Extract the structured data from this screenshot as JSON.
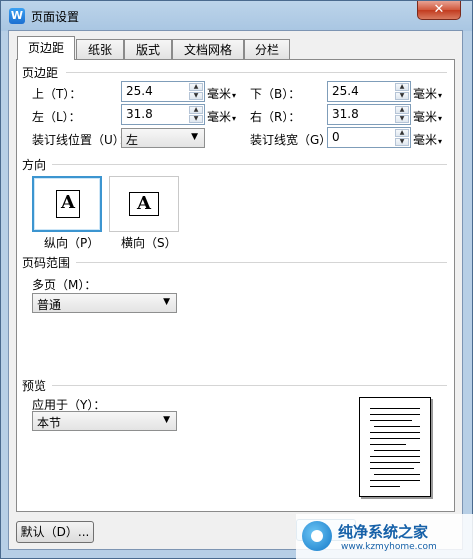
{
  "window": {
    "title": "页面设置",
    "app_icon_letter": "W",
    "close_label": "✕"
  },
  "tabs": [
    {
      "label": "页边距",
      "active": true
    },
    {
      "label": "纸张",
      "active": false
    },
    {
      "label": "版式",
      "active": false
    },
    {
      "label": "文档网格",
      "active": false
    },
    {
      "label": "分栏",
      "active": false
    }
  ],
  "margins": {
    "section_title": "页边距",
    "top": {
      "label": "上（T）：",
      "value": "25.4",
      "unit": "毫米"
    },
    "bottom": {
      "label": "下（B）：",
      "value": "25.4",
      "unit": "毫米"
    },
    "left": {
      "label": "左（L）：",
      "value": "31.8",
      "unit": "毫米"
    },
    "right": {
      "label": "右（R）：",
      "value": "31.8",
      "unit": "毫米"
    },
    "gutter_position": {
      "label": "装订线位置（U）：",
      "value": "左"
    },
    "gutter_width": {
      "label": "装订线宽（G）：",
      "value": "0",
      "unit": "毫米"
    }
  },
  "orientation": {
    "section_title": "方向",
    "portrait": {
      "label": "纵向（P）",
      "glyph": "A",
      "selected": true
    },
    "landscape": {
      "label": "横向（S）",
      "glyph": "A",
      "selected": false
    }
  },
  "pages": {
    "section_title": "页码范围",
    "multiple_label": "多页（M）：",
    "multiple_value": "普通"
  },
  "preview": {
    "section_title": "预览",
    "apply_label": "应用于（Y）：",
    "apply_value": "本节"
  },
  "footer": {
    "default_button": "默认（D）..."
  },
  "watermark": {
    "title": "纯净系统之家",
    "url": "www.kzmyhome.com"
  },
  "icons": {
    "spin_up": "spin-up-icon",
    "spin_down": "spin-down-icon",
    "dropdown": "dropdown-arrow-icon",
    "unit_caret": "unit-caret-icon"
  },
  "colors": {
    "selection_border": "#3c95d0",
    "title_gradient": "#a9c6e2",
    "panel_bg": "#ffffff"
  }
}
